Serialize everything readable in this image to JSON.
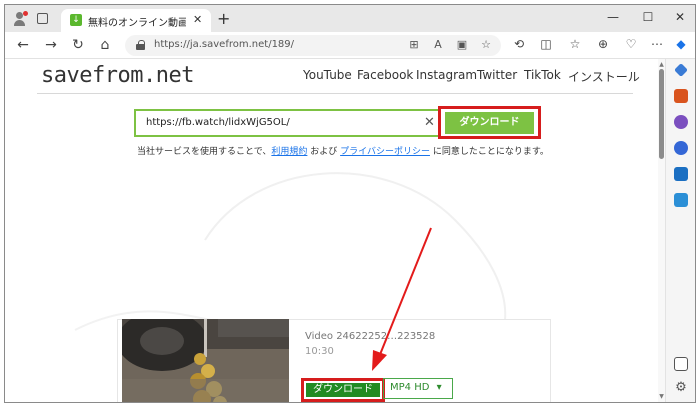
{
  "browser": {
    "tab": {
      "title": "無料のオンライン動画ダウンロード。動",
      "close_glyph": "✕"
    },
    "new_tab_glyph": "+",
    "window_controls": {
      "minimize": "—",
      "maximize": "☐",
      "close": "✕"
    },
    "address": {
      "url": "https://ja.savefrom.net/189/"
    }
  },
  "site": {
    "logo": "savefrom.net",
    "nav": [
      "YouTube",
      "Facebook",
      "Instagram",
      "Twitter",
      "TikTok",
      "インストール"
    ],
    "search": {
      "value": "https://fb.watch/lidxWjG5OL/",
      "clear_glyph": "✕"
    },
    "download_button": "ダウンロード",
    "terms": {
      "prefix": "当社サービスを使用することで、",
      "link1": "利用規約",
      "mid": " および ",
      "link2": "プライバシーポリシー",
      "suffix": " に同意したことになります。"
    }
  },
  "result": {
    "title": "Video 24622252…223528",
    "duration": "10:30",
    "download_button": "ダウンロード",
    "format": "MP4  HD",
    "format_chevron": "▾"
  },
  "colors": {
    "accent_green": "#7dc243",
    "dark_green": "#228b22",
    "highlight_red": "#d61d1d"
  }
}
